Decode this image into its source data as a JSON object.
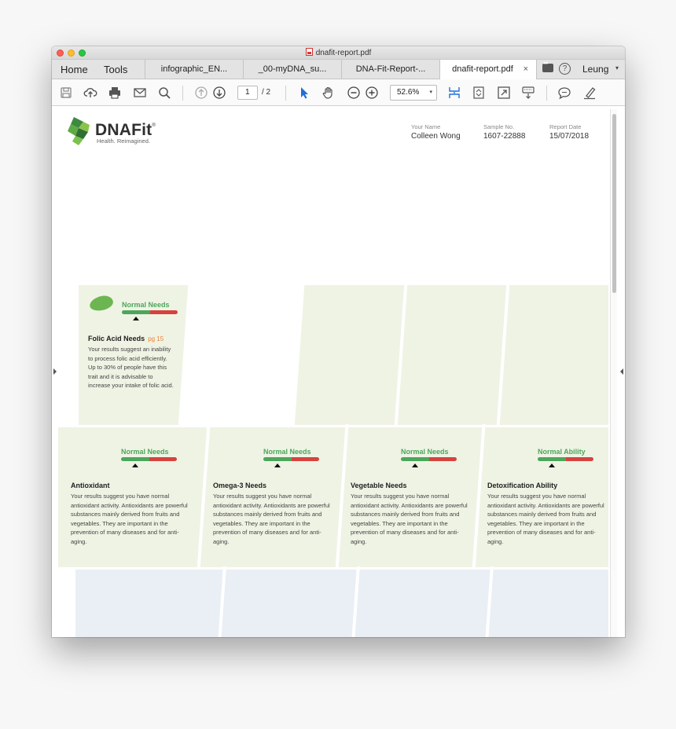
{
  "window": {
    "title": "dnafit-report.pdf"
  },
  "nav": {
    "home": "Home",
    "tools": "Tools"
  },
  "tabs": [
    {
      "label": "infographic_EN..."
    },
    {
      "label": "_00-myDNA_su..."
    },
    {
      "label": "DNA-Fit-Report-..."
    },
    {
      "label": "dnafit-report.pdf",
      "close": "×"
    }
  ],
  "account": {
    "help": "?",
    "user": "Leung",
    "caret": "▾"
  },
  "toolbar": {
    "page_current": "1",
    "page_total": "/ 2",
    "zoom": "52.6%",
    "zoom_caret": "▾"
  },
  "report": {
    "brand": "DNAFit",
    "registered": "®",
    "tagline": "Health. Reimagined.",
    "meta": [
      {
        "label": "Your Name",
        "value": "Colleen Wong"
      },
      {
        "label": "Sample No.",
        "value": "1607-22888"
      },
      {
        "label": "Report Date",
        "value": "15/07/2018"
      }
    ]
  },
  "cards": {
    "folic": {
      "status": "Normal Needs",
      "title": "Folic Acid Needs",
      "page_ref": "pg 15",
      "desc": "Your results suggest an inability to process folic acid efficiently. Up to 30% of people have this trait and it is advisable to increase your intake of folic acid.",
      "marker_fraction": 0.25
    },
    "row2": [
      {
        "status": "Normal Needs",
        "title": "Antioxidant",
        "desc": "Your results suggest you have normal antioxidant activity. Antioxidants are powerful substances mainly derived from fruits and vegetables. They are important in the prevention of many diseases and for anti-aging.",
        "marker_fraction": 0.25
      },
      {
        "status": "Normal Needs",
        "title": "Omega-3 Needs",
        "desc": "Your results suggest you have normal antioxidant activity. Antioxidants are powerful substances mainly derived from fruits and vegetables. They are important in the prevention of many diseases and for anti-aging.",
        "marker_fraction": 0.25
      },
      {
        "status": "Normal Needs",
        "title": "Vegetable Needs",
        "desc": "Your results suggest you have normal antioxidant activity. Antioxidants are powerful substances mainly derived from fruits and vegetables. They are important in the prevention of many diseases and for anti-aging.",
        "marker_fraction": 0.25
      },
      {
        "status": "Normal Ability",
        "title": "Detoxification Ability",
        "desc": "Your results suggest you have normal antioxidant activity. Antioxidants are powerful substances mainly derived from fruits and vegetables. They are important in the prevention of many diseases and for anti-aging.",
        "marker_fraction": 0.25
      }
    ]
  },
  "colors": {
    "green": "#4ca65c",
    "red": "#d6433d",
    "band": "#eff3e4",
    "band_blue": "#e9eff5",
    "accent": "#e8833a"
  },
  "icons": [
    "save-icon",
    "upload-cloud-icon",
    "print-icon",
    "mail-icon",
    "search-icon",
    "page-up-icon",
    "page-down-icon",
    "select-cursor-icon",
    "hand-icon",
    "zoom-out-icon",
    "zoom-in-icon",
    "scroll-mode-icon",
    "fit-page-icon",
    "fullscreen-icon",
    "keyboard-icon",
    "comment-icon",
    "highlight-pen-icon"
  ]
}
